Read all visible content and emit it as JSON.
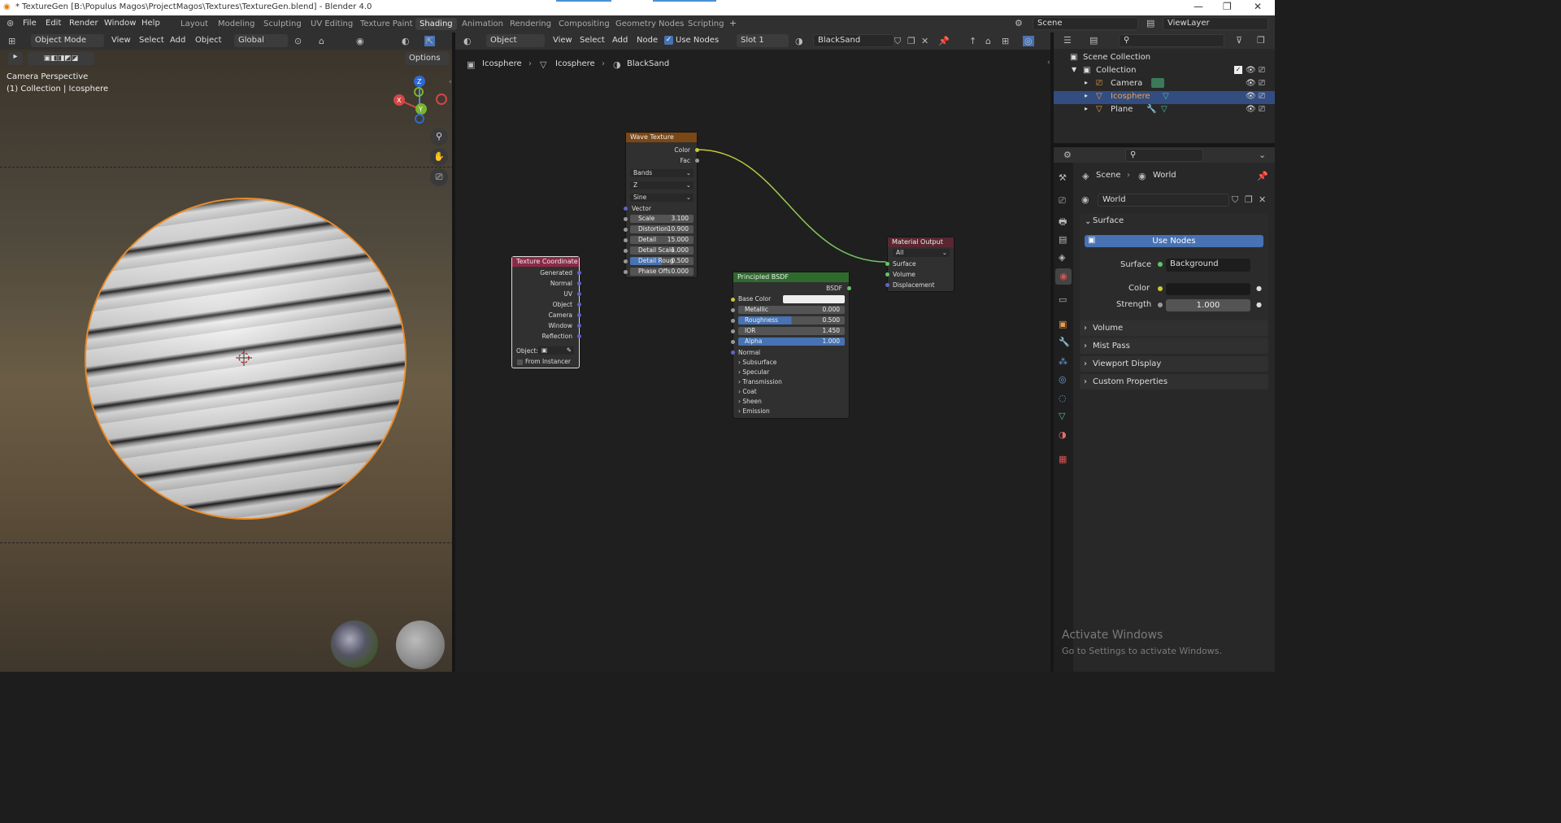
{
  "titlebar": {
    "title": "* TextureGen [B:\\Populus Magos\\ProjectMagos\\Textures\\TextureGen.blend] - Blender 4.0",
    "minimize": "—",
    "maximize": "❐",
    "close": "✕"
  },
  "menus": [
    "File",
    "Edit",
    "Render",
    "Window",
    "Help"
  ],
  "workspaces": [
    "Layout",
    "Modeling",
    "Sculpting",
    "UV Editing",
    "Texture Paint",
    "Shading",
    "Animation",
    "Rendering",
    "Compositing",
    "Geometry Nodes",
    "Scripting"
  ],
  "active_workspace": "Shading",
  "scene": "Scene",
  "view_layer": "ViewLayer",
  "viewport": {
    "mode": "Object Mode",
    "menu": [
      "View",
      "Select",
      "Add",
      "Object"
    ],
    "transform": "Global",
    "options": "Options",
    "overlay_title": "Camera Perspective",
    "overlay_sub": "(1) Collection | Icosphere"
  },
  "node_editor": {
    "type": "Object",
    "menu": [
      "View",
      "Select",
      "Add",
      "Node"
    ],
    "use_nodes": "Use Nodes",
    "slot": "Slot 1",
    "material": "BlackSand",
    "breadcrumb": [
      "Icosphere",
      "Icosphere",
      "BlackSand"
    ]
  },
  "nodes": {
    "wave": {
      "title": "Wave Texture",
      "outputs": [
        "Color",
        "Fac"
      ],
      "dropdowns": [
        "Bands",
        "Z",
        "Sine"
      ],
      "vector": "Vector",
      "fields": [
        {
          "label": "Scale",
          "value": "3.100"
        },
        {
          "label": "Distortion",
          "value": "10.900"
        },
        {
          "label": "Detail",
          "value": "15.000"
        },
        {
          "label": "Detail Scale",
          "value": "1.000"
        },
        {
          "label": "Detail Roug",
          "value": "0.500"
        },
        {
          "label": "Phase Offs",
          "value": "0.000"
        }
      ]
    },
    "texcoord": {
      "title": "Texture Coordinate",
      "outputs": [
        "Generated",
        "Normal",
        "UV",
        "Object",
        "Camera",
        "Window",
        "Reflection"
      ],
      "object_label": "Object:",
      "from_instancer": "From Instancer"
    },
    "bsdf": {
      "title": "Principled BSDF",
      "output": "BSDF",
      "base_color": "Base Color",
      "fields": [
        {
          "label": "Metallic",
          "value": "0.000"
        },
        {
          "label": "Roughness",
          "value": "0.500"
        },
        {
          "label": "IOR",
          "value": "1.450"
        },
        {
          "label": "Alpha",
          "value": "1.000"
        }
      ],
      "normal": "Normal",
      "sections": [
        "Subsurface",
        "Specular",
        "Transmission",
        "Coat",
        "Sheen",
        "Emission"
      ]
    },
    "output": {
      "title": "Material Output",
      "target": "All",
      "inputs": [
        "Surface",
        "Volume",
        "Displacement"
      ]
    }
  },
  "outliner": {
    "root": "Scene Collection",
    "collection": "Collection",
    "items": [
      "Camera",
      "Icosphere",
      "Plane"
    ]
  },
  "properties": {
    "breadcrumb": [
      "Scene",
      "World"
    ],
    "world": "World",
    "surface_panel": "Surface",
    "use_nodes": "Use Nodes",
    "surface_label": "Surface",
    "surface_value": "Background",
    "color_label": "Color",
    "strength_label": "Strength",
    "strength_value": "1.000",
    "panels": [
      "Volume",
      "Mist Pass",
      "Viewport Display",
      "Custom Properties"
    ]
  },
  "watermark": {
    "title": "Activate Windows",
    "sub": "Go to Settings to activate Windows."
  },
  "colors": {
    "accent": "#4772b3",
    "selection": "#e88a2a",
    "wave_header": "#7a4716",
    "texcoord_header": "#8b2a47",
    "bsdf_header": "#2e6a2e",
    "output_header": "#5a2730"
  }
}
